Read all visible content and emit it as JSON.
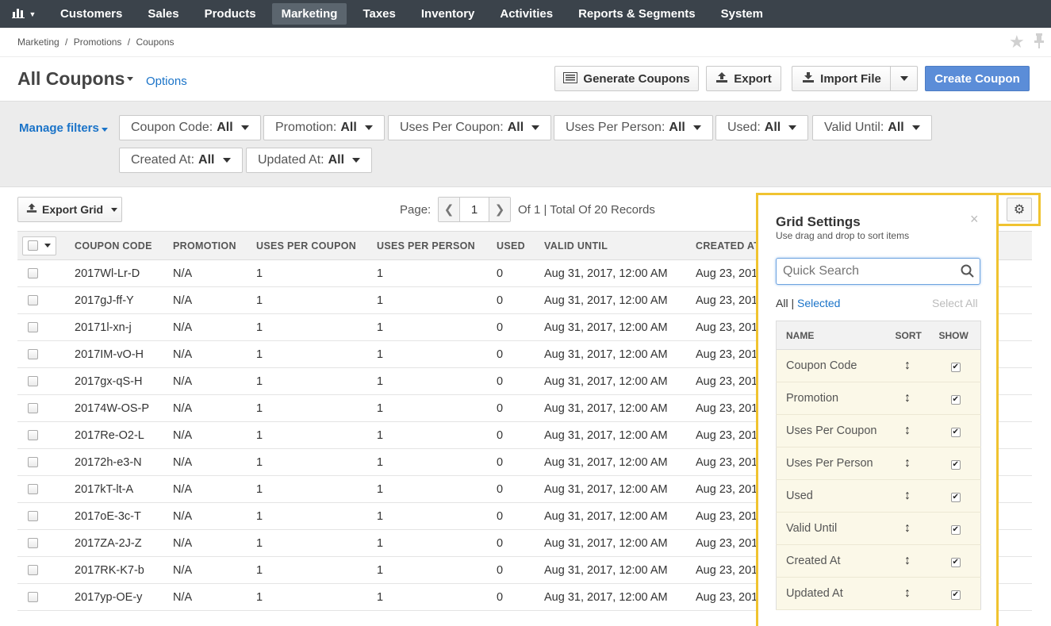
{
  "nav": {
    "logo_icon": "bar-chart-icon",
    "items": [
      "Customers",
      "Sales",
      "Products",
      "Marketing",
      "Taxes",
      "Inventory",
      "Activities",
      "Reports & Segments",
      "System"
    ],
    "active": "Marketing"
  },
  "breadcrumb": [
    "Marketing",
    "/",
    "Promotions",
    "/",
    "Coupons"
  ],
  "header": {
    "title": "All Coupons",
    "options": "Options",
    "generate": "Generate Coupons",
    "export": "Export",
    "import": "Import File",
    "create": "Create Coupon"
  },
  "filters": {
    "manage": "Manage filters",
    "items": [
      {
        "label": "Coupon Code:",
        "value": "All"
      },
      {
        "label": "Promotion:",
        "value": "All"
      },
      {
        "label": "Uses Per Coupon:",
        "value": "All"
      },
      {
        "label": "Uses Per Person:",
        "value": "All"
      },
      {
        "label": "Used:",
        "value": "All"
      },
      {
        "label": "Valid Until:",
        "value": "All"
      },
      {
        "label": "Created At:",
        "value": "All"
      },
      {
        "label": "Updated At:",
        "value": "All"
      }
    ]
  },
  "toolbar": {
    "export_grid": "Export Grid",
    "page_label": "Page:",
    "page": "1",
    "records": "Of 1 | Total Of 20 Records"
  },
  "table": {
    "columns": [
      "COUPON CODE",
      "PROMOTION",
      "USES PER COUPON",
      "USES PER PERSON",
      "USED",
      "VALID UNTIL",
      "CREATED AT"
    ],
    "rows": [
      [
        "2017Wl-Lr-D",
        "N/A",
        "1",
        "1",
        "0",
        "Aug 31, 2017, 12:00 AM",
        "Aug 23, 201"
      ],
      [
        "2017gJ-ff-Y",
        "N/A",
        "1",
        "1",
        "0",
        "Aug 31, 2017, 12:00 AM",
        "Aug 23, 201"
      ],
      [
        "20171l-xn-j",
        "N/A",
        "1",
        "1",
        "0",
        "Aug 31, 2017, 12:00 AM",
        "Aug 23, 201"
      ],
      [
        "2017IM-vO-H",
        "N/A",
        "1",
        "1",
        "0",
        "Aug 31, 2017, 12:00 AM",
        "Aug 23, 201"
      ],
      [
        "2017gx-qS-H",
        "N/A",
        "1",
        "1",
        "0",
        "Aug 31, 2017, 12:00 AM",
        "Aug 23, 201"
      ],
      [
        "20174W-OS-P",
        "N/A",
        "1",
        "1",
        "0",
        "Aug 31, 2017, 12:00 AM",
        "Aug 23, 201"
      ],
      [
        "2017Re-O2-L",
        "N/A",
        "1",
        "1",
        "0",
        "Aug 31, 2017, 12:00 AM",
        "Aug 23, 201"
      ],
      [
        "20172h-e3-N",
        "N/A",
        "1",
        "1",
        "0",
        "Aug 31, 2017, 12:00 AM",
        "Aug 23, 201"
      ],
      [
        "2017kT-lt-A",
        "N/A",
        "1",
        "1",
        "0",
        "Aug 31, 2017, 12:00 AM",
        "Aug 23, 201"
      ],
      [
        "2017oE-3c-T",
        "N/A",
        "1",
        "1",
        "0",
        "Aug 31, 2017, 12:00 AM",
        "Aug 23, 201"
      ],
      [
        "2017ZA-2J-Z",
        "N/A",
        "1",
        "1",
        "0",
        "Aug 31, 2017, 12:00 AM",
        "Aug 23, 201"
      ],
      [
        "2017RK-K7-b",
        "N/A",
        "1",
        "1",
        "0",
        "Aug 31, 2017, 12:00 AM",
        "Aug 23, 201"
      ],
      [
        "2017yp-OE-y",
        "N/A",
        "1",
        "1",
        "0",
        "Aug 31, 2017, 12:00 AM",
        "Aug 23, 201"
      ]
    ]
  },
  "grid_settings": {
    "title": "Grid Settings",
    "subtitle": "Use drag and drop to sort items",
    "search_placeholder": "Quick Search",
    "all": "All",
    "sep": "|",
    "selected": "Selected",
    "select_all": "Select All",
    "columns": [
      "NAME",
      "SORT",
      "SHOW"
    ],
    "items": [
      "Coupon Code",
      "Promotion",
      "Uses Per Coupon",
      "Uses Per Person",
      "Used",
      "Valid Until",
      "Created At",
      "Updated At"
    ]
  },
  "colors": {
    "nav_bg": "#3b434b",
    "primary": "#5b8dd8",
    "link": "#1a73c8",
    "highlight": "#f0c330"
  }
}
